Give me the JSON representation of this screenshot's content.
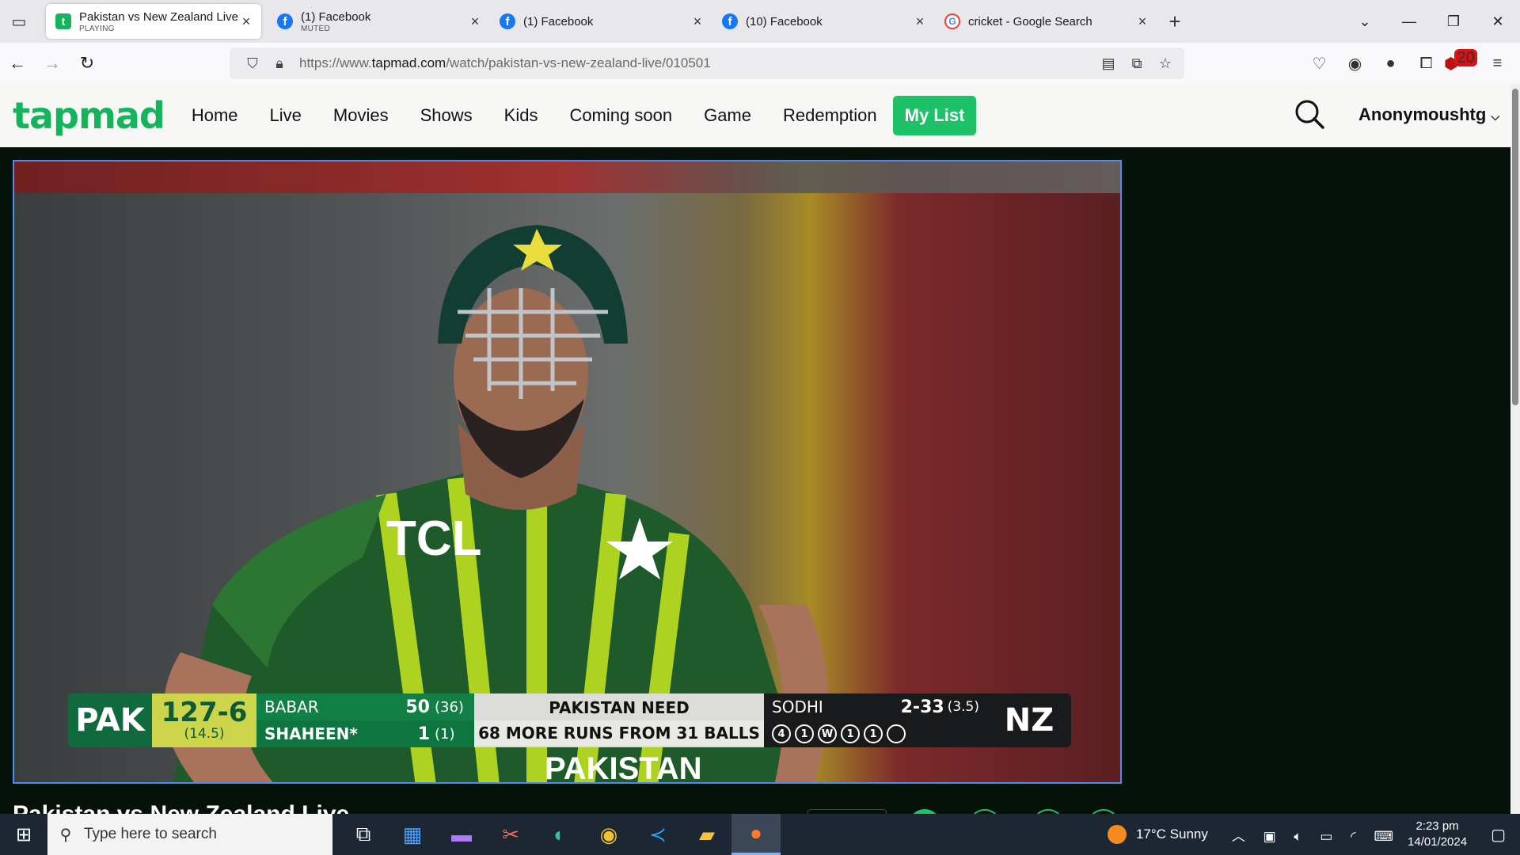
{
  "browser": {
    "tabs": [
      {
        "title": "Pakistan vs New Zealand Live Li",
        "sub": "PLAYING",
        "icon": "tapmad-favicon",
        "active": true
      },
      {
        "title": "(1) Facebook",
        "sub": "MUTED",
        "icon": "facebook-favicon"
      },
      {
        "title": "(1) Facebook",
        "sub": "",
        "icon": "facebook-favicon"
      },
      {
        "title": "(10) Facebook",
        "sub": "",
        "icon": "facebook-favicon"
      },
      {
        "title": "cricket - Google Search",
        "sub": "",
        "icon": "google-favicon"
      }
    ],
    "url_prefix": "https://www.",
    "url_domain": "tapmad.com",
    "url_path": "/watch/pakistan-vs-new-zealand-live/010501",
    "extension_badge": "20"
  },
  "site": {
    "logo": "tapmad",
    "menu": [
      "Home",
      "Live",
      "Movies",
      "Shows",
      "Kids",
      "Coming soon",
      "Game",
      "Redemption"
    ],
    "my_list": "My List",
    "user": "Anonymoushtg"
  },
  "scoreboard": {
    "team": "PAK",
    "total": "127-6",
    "overs": "(14.5)",
    "batters": [
      {
        "name": "BABAR",
        "runs": "50",
        "balls": "(36)"
      },
      {
        "name": "SHAHEEN*",
        "runs": "1",
        "balls": "(1)"
      }
    ],
    "need_line1": "PAKISTAN NEED",
    "need_line2": "68 MORE RUNS FROM 31 BALLS",
    "bowler": "SODHI",
    "bowler_figures": "2-33",
    "bowler_overs": "(3.5)",
    "balls": [
      "4",
      "1",
      "W",
      "1",
      "1",
      ""
    ],
    "opponent": "NZ"
  },
  "page": {
    "video_title": "Pakistan vs New Zealand Live"
  },
  "taskbar": {
    "search_placeholder": "Type here to search",
    "weather": "17°C  Sunny",
    "time": "2:23 pm",
    "date": "14/01/2024"
  },
  "colors": {
    "brand_green": "#16b35d",
    "mylist_green": "#1fc168",
    "player_border": "#4c8ee8"
  }
}
